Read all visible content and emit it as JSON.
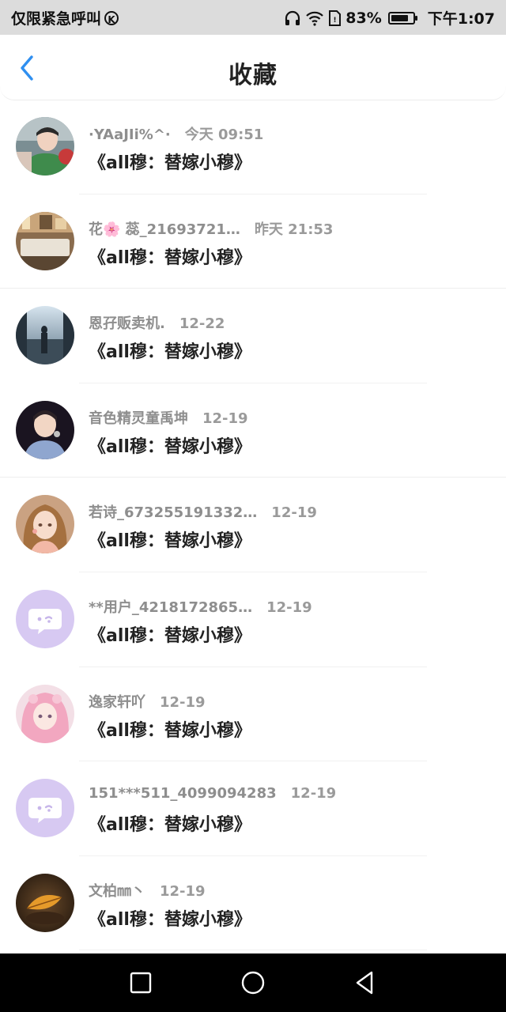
{
  "status_bar": {
    "carrier": "仅限紧急呼叫",
    "battery_text": "83%",
    "battery_level": 0.83,
    "time": "下午1:07",
    "icons": [
      "k-icon",
      "headphones-icon",
      "wifi-icon",
      "sim-icon",
      "battery-icon"
    ]
  },
  "header": {
    "title": "收藏",
    "back_icon": "chevron-left-icon",
    "accent_color": "#2f8ff0"
  },
  "items": [
    {
      "username": "·YAaJIi%^·",
      "time": "今天 09:51",
      "work": "《all穆：替嫁小穆》",
      "avatar": "photo-boy-green"
    },
    {
      "username": "花🌸 蕊_21693721…",
      "time": "昨天 21:53",
      "work": "《all穆：替嫁小穆》",
      "avatar": "photo-room"
    },
    {
      "username": "恩孖贩卖机.",
      "time": "12-22",
      "work": "《all穆：替嫁小穆》",
      "avatar": "photo-window"
    },
    {
      "username": "音色精灵童禹坤",
      "time": "12-19",
      "work": "《all穆：替嫁小穆》",
      "avatar": "photo-singer"
    },
    {
      "username": "若诗_673255191332…",
      "time": "12-19",
      "work": "《all穆：替嫁小穆》",
      "avatar": "photo-anime-girl"
    },
    {
      "username": "**用户_4218172865…",
      "time": "12-19",
      "work": "《all穆：替嫁小穆》",
      "avatar": "default-chat-avatar"
    },
    {
      "username": "逸家轩吖",
      "time": "12-19",
      "work": "《all穆：替嫁小穆》",
      "avatar": "photo-pink-girl"
    },
    {
      "username": "151***511_4099094283",
      "time": "12-19",
      "work": "《all穆：替嫁小穆》",
      "avatar": "default-chat-avatar"
    },
    {
      "username": "文柏㎜丶",
      "time": "12-19",
      "work": "《all穆：替嫁小穆》",
      "avatar": "photo-leaf"
    }
  ],
  "nav_bar": {
    "icons": [
      "recent-apps-icon",
      "home-icon",
      "back-icon"
    ]
  }
}
